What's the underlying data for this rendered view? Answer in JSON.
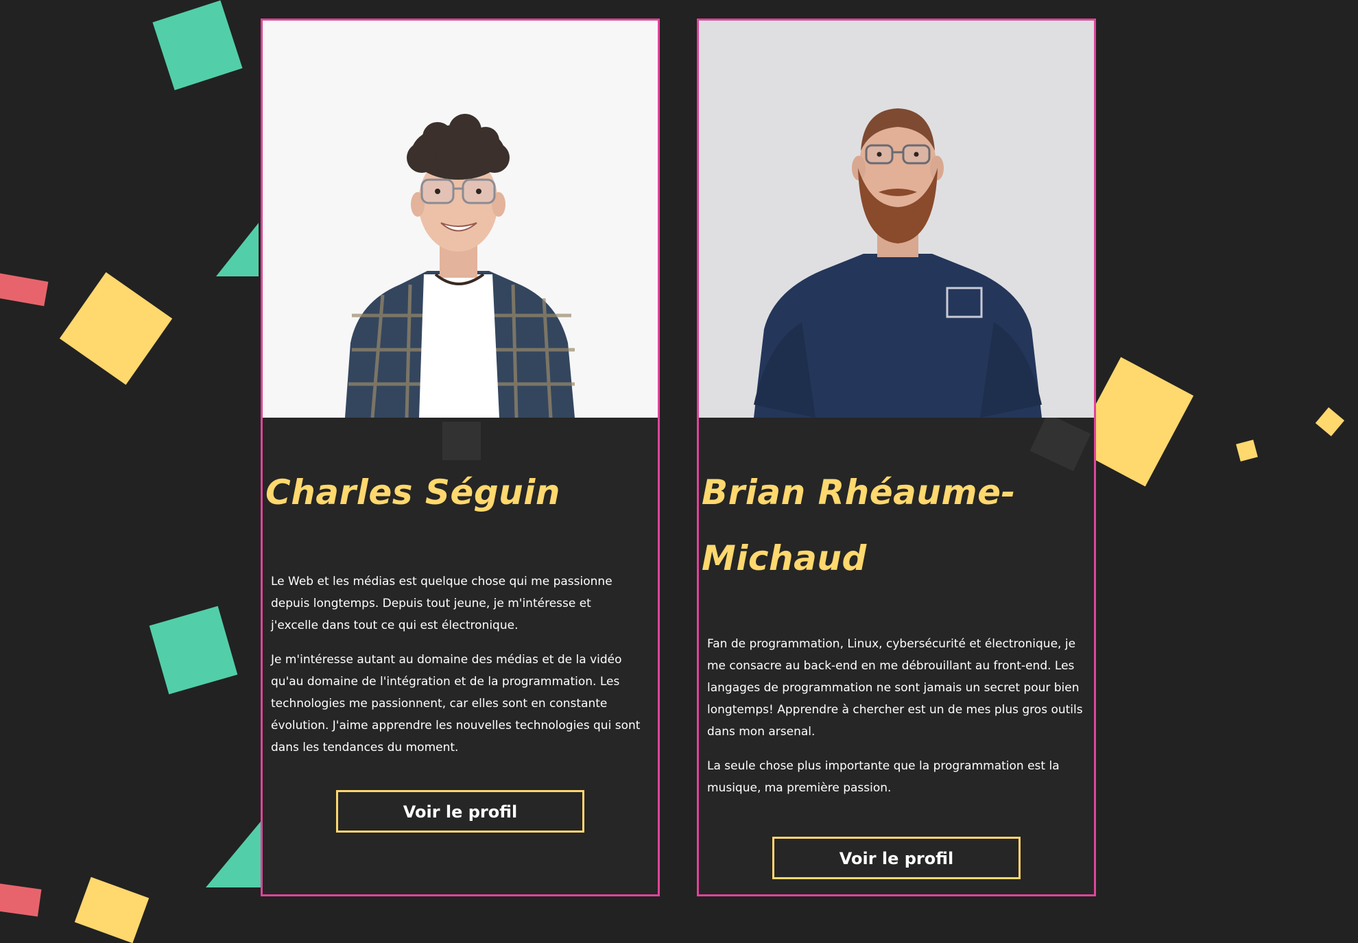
{
  "theme": {
    "background": "#222222",
    "card_border": "#e0449a",
    "accent_yellow": "#ffd86e",
    "accent_green": "#52cfa8",
    "accent_red": "#e8646c"
  },
  "team": {
    "members": [
      {
        "name": "Charles Séguin",
        "photo_icon": "person-photo-charles",
        "bio": [
          "Le Web et les médias est quelque chose qui me passionne depuis longtemps. Depuis tout jeune, je m'intéresse et j'excelle dans tout ce qui est électronique.",
          "Je m'intéresse autant au domaine des médias et de la vidéo qu'au domaine de l'intégration et de la programmation. Les technologies me passionnent, car elles sont en constante évolution. J'aime apprendre les nouvelles technologies qui sont dans les tendances du moment."
        ],
        "button_label": "Voir le profil"
      },
      {
        "name": "Brian Rhéaume-Michaud",
        "photo_icon": "person-photo-brian",
        "bio": [
          "Fan de programmation, Linux, cybersécurité et électronique, je me consacre au back-end en me débrouillant au front-end. Les langages de programmation ne sont jamais un secret pour bien longtemps! Apprendre à chercher est un de mes plus gros outils dans mon arsenal.",
          "La seule chose plus importante que la programmation est la musique, ma première passion."
        ],
        "button_label": "Voir le profil"
      }
    ]
  }
}
